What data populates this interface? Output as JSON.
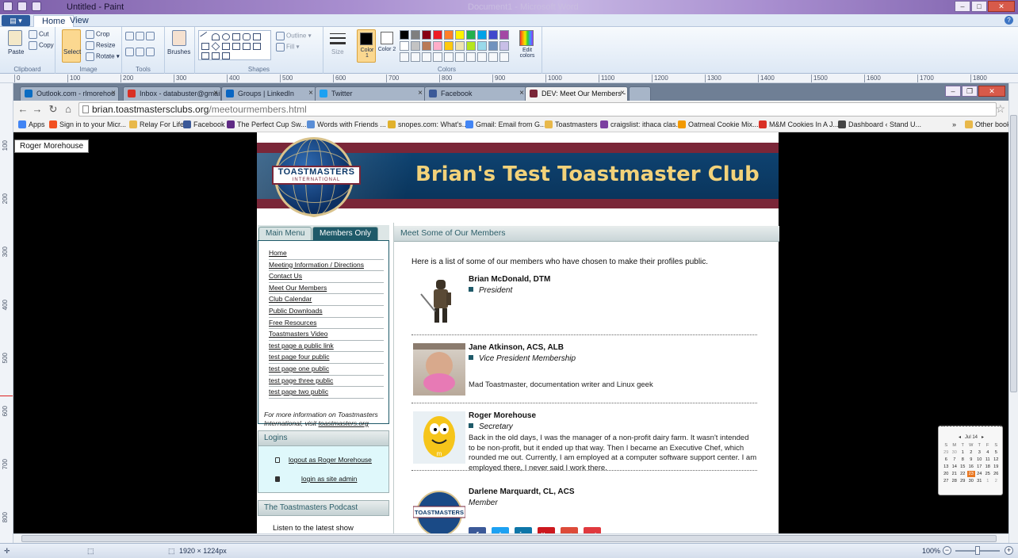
{
  "paint": {
    "title": "Untitled - Paint",
    "ghost_title": "Document1 - Microsoft Word",
    "tabs": [
      "Home",
      "View"
    ],
    "groups": {
      "clipboard": "Clipboard",
      "image": "Image",
      "tools": "Tools",
      "shapes": "Shapes",
      "colors": "Colors"
    },
    "buttons": {
      "paste": "Paste",
      "cut": "Cut",
      "copy": "Copy",
      "select": "Select",
      "crop": "Crop",
      "resize": "Resize",
      "rotate": "Rotate",
      "brushes": "Brushes",
      "outline": "Outline",
      "fill": "Fill",
      "size": "Size",
      "color1": "Color 1",
      "color2": "Color 2",
      "edit_colors": "Edit colors"
    },
    "palette": [
      "#000000",
      "#7f7f7f",
      "#880015",
      "#ed1c24",
      "#ff7f27",
      "#fff200",
      "#22b14c",
      "#00a2e8",
      "#3f48cc",
      "#a349a4",
      "#ffffff",
      "#c3c3c3",
      "#b97a57",
      "#ffaec9",
      "#ffc90e",
      "#efe4b0",
      "#b5e61d",
      "#99d9ea",
      "#7092be",
      "#c8bfe7"
    ],
    "ruler_marks": [
      "0",
      "100",
      "200",
      "300",
      "400",
      "500",
      "600",
      "700",
      "800",
      "900",
      "1000",
      "1100",
      "1200",
      "1300",
      "1400",
      "1500",
      "1600",
      "1700",
      "1800"
    ],
    "ruler_left_marks": [
      "100",
      "200",
      "300",
      "400",
      "500",
      "600",
      "700",
      "800"
    ],
    "status": {
      "dimensions": "1920 × 1224px",
      "zoom": "100%"
    }
  },
  "browser": {
    "tabs": [
      {
        "label": "Outlook.com - rlmorehou",
        "color": "#0a6cc2"
      },
      {
        "label": "Inbox - databuster@gmail",
        "color": "#d93025"
      },
      {
        "label": "Groups | LinkedIn",
        "color": "#0a66c2"
      },
      {
        "label": "Twitter",
        "color": "#1da1f2"
      },
      {
        "label": "Facebook",
        "color": "#3b5998"
      },
      {
        "label": "DEV: Meet Our Members -",
        "color": "#7a2638"
      }
    ],
    "url_host": "brian.toastmastersclubs.org",
    "url_path": "/meetourmembers.html",
    "bookmarks": [
      {
        "label": "Apps",
        "color": "#4285f4"
      },
      {
        "label": "Sign in to your Micr...",
        "color": "#f25022"
      },
      {
        "label": "Relay For Life",
        "color": "#e8b84a"
      },
      {
        "label": "Facebook",
        "color": "#3b5998"
      },
      {
        "label": "The Perfect Cup Sw...",
        "color": "#5f2a84"
      },
      {
        "label": "Words with Friends ...",
        "color": "#5a8ed6"
      },
      {
        "label": "snopes.com: What's...",
        "color": "#e1b12c"
      },
      {
        "label": "Gmail: Email from G...",
        "color": "#4285f4"
      },
      {
        "label": "Toastmasters",
        "color": "#e8b84a"
      },
      {
        "label": "craigslist: ithaca clas...",
        "color": "#7b3fa0"
      },
      {
        "label": "Oatmeal Cookie Mix...",
        "color": "#f29900"
      },
      {
        "label": "M&M Cookies In A J...",
        "color": "#d93025"
      },
      {
        "label": "Dashboard ‹ Stand U...",
        "color": "#444444"
      },
      {
        "label": "Other book",
        "color": "#e8b84a"
      }
    ],
    "overflow": "»"
  },
  "tooltip": "Roger Morehouse",
  "site": {
    "logo_main": "TOASTMASTERS",
    "logo_sub": "INTERNATIONAL",
    "club_title": "Brian's Test Toastmaster Club",
    "side_tabs": [
      "Main Menu",
      "Members Only"
    ],
    "nav": [
      "Home",
      "Meeting Information / Directions",
      "Contact Us",
      "Meet Our Members",
      "Club Calendar",
      "Public Downloads",
      "Free Resources",
      "Toastmasters Video",
      "test page a public link",
      "test page four public",
      "test page one public",
      "test page three public",
      "test page two public"
    ],
    "more_info_prefix": "For more information on Toastmasters International, visit",
    "more_info_link": "toastmasters.org",
    "logins_header": "Logins",
    "logout_link": "logout as Roger Morehouse",
    "admin_link": "login as site admin",
    "podcast_header": "The Toastmasters Podcast",
    "podcast_text": "Listen to the latest show",
    "main_header": "Meet Some of Our Members",
    "intro": "Here is a list of some of our members who have chosen to make their profiles public.",
    "members": [
      {
        "name": "Brian McDonald, DTM",
        "role": "President",
        "bio": ""
      },
      {
        "name": "Jane Atkinson, ACS, ALB",
        "role": "Vice President Membership",
        "bio": "Mad Toastmaster, documentation writer and Linux geek"
      },
      {
        "name": "Roger Morehouse",
        "role": "Secretary",
        "bio": "Back in the old days, I was the manager of a non-profit dairy farm. It wasn't intended to be non-profit, but it ended up that way. Then I became an Executive Chef, which rounded me out. Currently, I am employed at a computer software support center. I am employed there, I never said I work there."
      },
      {
        "name": "Darlene Marquardt, CL, ACS",
        "role": "Member",
        "bio": ""
      }
    ],
    "social": [
      {
        "label": "f",
        "color": "#3b5998"
      },
      {
        "label": "t",
        "color": "#1da1f2"
      },
      {
        "label": "in",
        "color": "#0e76a8"
      },
      {
        "label": "You",
        "color": "#cc181e"
      },
      {
        "label": "g+",
        "color": "#dd4b39"
      },
      {
        "label": "meetup",
        "color": "#e0393e"
      }
    ]
  },
  "calendar": {
    "month": "Jul 14",
    "headers": [
      "S",
      "M",
      "T",
      "W",
      "T",
      "F",
      "S"
    ],
    "days": [
      "29",
      "30",
      "1",
      "2",
      "3",
      "4",
      "5",
      "6",
      "7",
      "8",
      "9",
      "10",
      "11",
      "12",
      "13",
      "14",
      "15",
      "16",
      "17",
      "18",
      "19",
      "20",
      "21",
      "22",
      "23",
      "24",
      "25",
      "26",
      "27",
      "28",
      "29",
      "30",
      "31",
      "1",
      "2"
    ],
    "today": "23"
  }
}
